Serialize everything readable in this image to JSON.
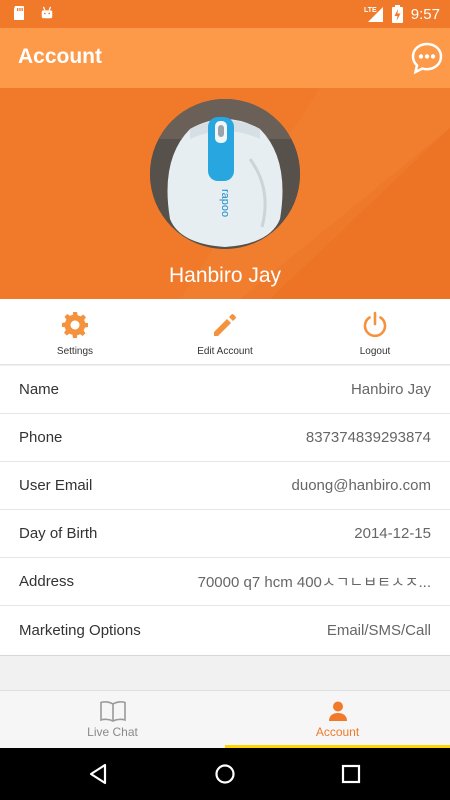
{
  "status_bar": {
    "time": "9:57",
    "network": "LTE",
    "icons": [
      "sd-card-icon",
      "android-icon",
      "lte-signal-icon",
      "battery-charging-icon"
    ]
  },
  "app_bar": {
    "title": "Account",
    "chat_icon": "chat-bubble-icon"
  },
  "profile": {
    "name": "Hanbiro Jay"
  },
  "actions": [
    {
      "label": "Settings",
      "icon": "gear-icon"
    },
    {
      "label": "Edit Account",
      "icon": "pencil-icon"
    },
    {
      "label": "Logout",
      "icon": "power-icon"
    }
  ],
  "info": [
    {
      "key": "Name",
      "value": "Hanbiro Jay"
    },
    {
      "key": "Phone",
      "value": "837374839293874"
    },
    {
      "key": "User Email",
      "value": "duong@hanbiro.com"
    },
    {
      "key": "Day of Birth",
      "value": "2014-12-15"
    },
    {
      "key": "Address",
      "value": "70000 q7 hcm 400ㅅㄱㄴㅂㅌㅅㅈ..."
    },
    {
      "key": "Marketing Options",
      "value": "Email/SMS/Call"
    }
  ],
  "bottom_nav": {
    "tabs": [
      {
        "label": "Live Chat",
        "icon": "book-icon",
        "active": false
      },
      {
        "label": "Account",
        "icon": "person-icon",
        "active": true
      }
    ]
  },
  "colors": {
    "primary": "#f07a2a",
    "app_bar": "#fd9a4a",
    "active_indicator": "#ffd400",
    "icon_orange": "#f5923e"
  }
}
